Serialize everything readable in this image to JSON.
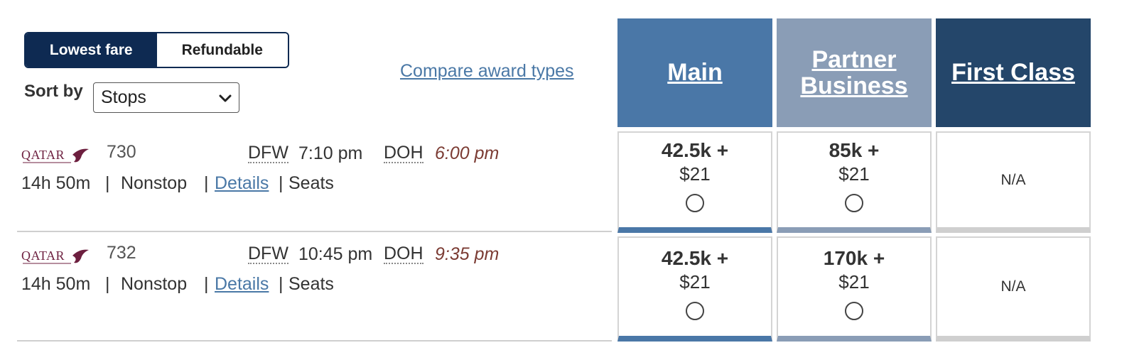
{
  "fare_toggle": {
    "lowest_label": "Lowest fare",
    "refundable_label": "Refundable",
    "selected": "Lowest fare"
  },
  "sort": {
    "label": "Sort by",
    "selected": "Stops"
  },
  "compare_link": "Compare award types",
  "columns": [
    {
      "label_line1": "Main",
      "label_line2": "",
      "color": "#4a77a7"
    },
    {
      "label_line1": "Partner",
      "label_line2": "Business",
      "color": "#8a9db6"
    },
    {
      "label_line1": "First Class",
      "label_line2": "",
      "color": "#24466a"
    }
  ],
  "flights": [
    {
      "airline_logo": "QATAR",
      "flight_number": "730",
      "depart_airport": "DFW",
      "depart_time": "7:10 pm",
      "arrive_airport": "DOH",
      "arrive_time": "6:00 pm",
      "duration": "14h 50m",
      "stops": "Nonstop",
      "details_label": "Details",
      "seats_label": "Seats",
      "fares": [
        {
          "miles": "42.5k +",
          "cash": "$21"
        },
        {
          "miles": "85k +",
          "cash": "$21"
        },
        {
          "na": "N/A"
        }
      ]
    },
    {
      "airline_logo": "QATAR",
      "flight_number": "732",
      "depart_airport": "DFW",
      "depart_time": "10:45 pm",
      "arrive_airport": "DOH",
      "arrive_time": "9:35 pm",
      "duration": "14h 50m",
      "stops": "Nonstop",
      "details_label": "Details",
      "seats_label": "Seats",
      "fares": [
        {
          "miles": "42.5k +",
          "cash": "$21"
        },
        {
          "miles": "170k +",
          "cash": "$21"
        },
        {
          "na": "N/A"
        }
      ]
    }
  ],
  "icons": {
    "logo": "qatar-airways-logo-icon",
    "select": "chevron-down-icon",
    "radio": "radio-button-icon"
  },
  "colors": {
    "toggle_active": "#0e2a52",
    "link": "#4a78a6",
    "arrival_time": "#7b3b33"
  }
}
